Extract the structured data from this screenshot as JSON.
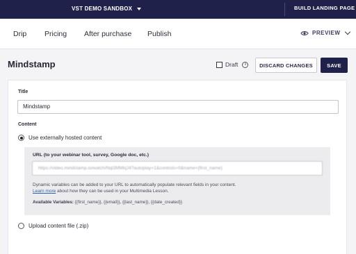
{
  "topbar": {
    "workspace": "VST DEMO SANDBOX",
    "build_button": "BUILD LANDING PAGE"
  },
  "tabs": {
    "items": [
      "Drip",
      "Pricing",
      "After purchase",
      "Publish"
    ],
    "preview_label": "PREVIEW"
  },
  "header": {
    "title": "Mindstamp",
    "draft_label": "Draft",
    "discard_label": "DISCARD CHANGES",
    "save_label": "SAVE"
  },
  "form": {
    "title_label": "Title",
    "title_value": "Mindstamp",
    "content_label": "Content",
    "option_external": "Use externally hosted content",
    "option_upload": "Upload content file (.zip)",
    "selected_option": "external",
    "url_label": "URL (to your webinar tool, survey, Google doc, etc.)",
    "url_value": "https://video.mindstamp.io/watch/Nql3MMkjJ4?autoplay=1&controls=0&name={first_name}",
    "help_text": "Dynamic variables can be added to your URL to automatically populate relevant fields in your content.",
    "learn_more": "Learn more",
    "help_suffix": " about how they can be used in your Multimedia Lesson.",
    "vars_label": "Available Variables:",
    "vars_value": " {{first_name}}, {{email}}, {{last_name}}, {{date_created}}"
  },
  "colors": {
    "navy": "#20214a",
    "link": "#2f5fa8"
  }
}
